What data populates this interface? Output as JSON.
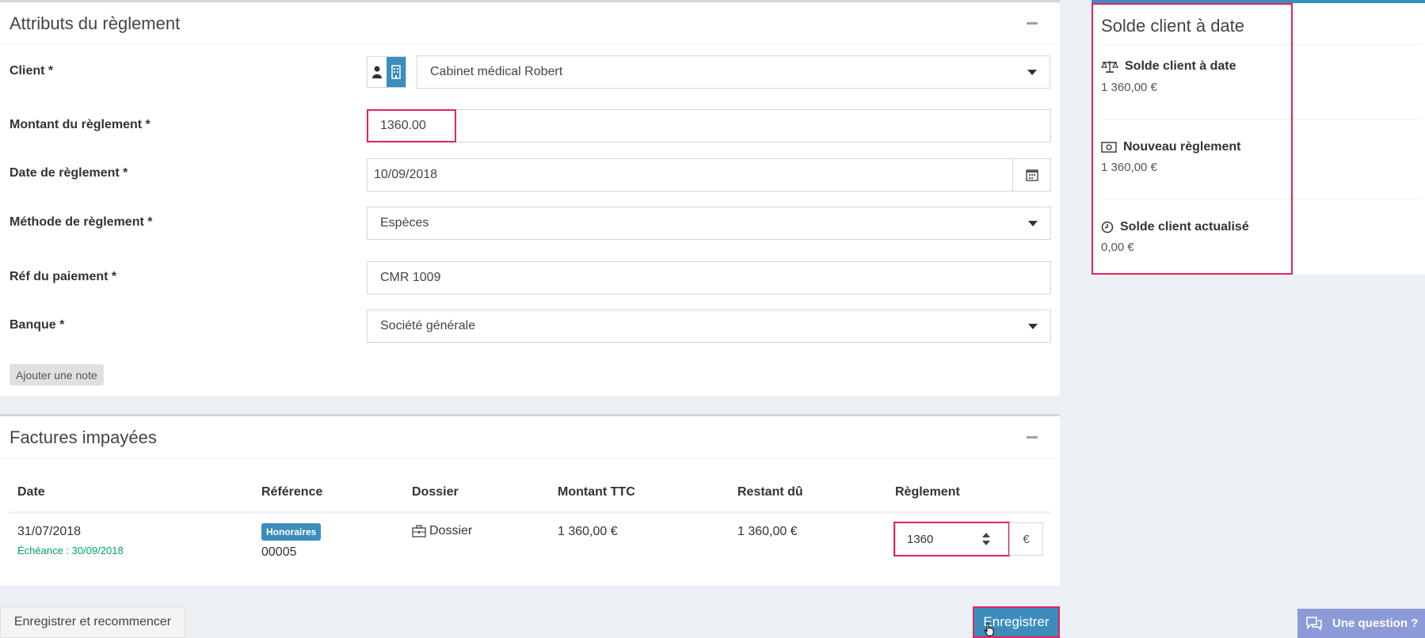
{
  "attributes": {
    "title": "Attributs du règlement",
    "client_label": "Client *",
    "client_value": "Cabinet médical Robert",
    "amount_label": "Montant du règlement *",
    "amount_value": "1360.00",
    "date_label": "Date de règlement *",
    "date_value": "10/09/2018",
    "method_label": "Méthode de règlement *",
    "method_value": "Espèces",
    "ref_label": "Réf du paiement *",
    "ref_value": "CMR 1009",
    "bank_label": "Banque *",
    "bank_value": "Société générale",
    "add_note": "Ajouter une note"
  },
  "invoices": {
    "title": "Factures impayées",
    "columns": [
      "Date",
      "Référence",
      "Dossier",
      "Montant TTC",
      "Restant dû",
      "Règlement"
    ],
    "row": {
      "date": "31/07/2018",
      "due": "Échéance : 30/09/2018",
      "badge": "Honoraires",
      "reference": "00005",
      "dossier": "Dossier",
      "amount": "1 360,00 €",
      "remaining": "1 360,00 €",
      "payment": "1360",
      "currency": "€"
    }
  },
  "actions": {
    "save_restart": "Enregistrer et recommencer",
    "save": "Enregistrer"
  },
  "balance": {
    "title": "Solde client à date",
    "items": [
      {
        "label": "Solde client à date",
        "value": "1 360,00 €",
        "icon": "balance-scale-icon"
      },
      {
        "label": "Nouveau règlement",
        "value": "1 360,00 €",
        "icon": "money-bill-icon"
      },
      {
        "label": "Solde client actualisé",
        "value": "0,00 €",
        "icon": "clock-icon"
      }
    ]
  },
  "chat": {
    "label": "Une question ?"
  },
  "colors": {
    "primary": "#3c8dbc",
    "highlight": "#e0245e",
    "success": "#00a65a",
    "chat": "#8c9bd8"
  }
}
